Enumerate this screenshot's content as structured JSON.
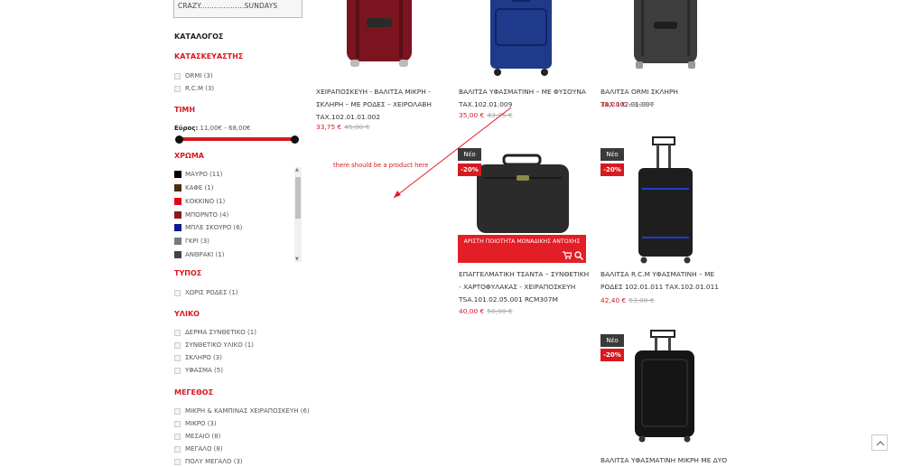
{
  "sidebar": {
    "coupon_text": "CRAZY...................SUNDAYS",
    "catalog_heading": "ΚΑΤΑΛΟΓΟΣ",
    "manufacturer": {
      "heading": "ΚΑΤΑΣΚΕΥΑΣΤΗΣ",
      "items": [
        {
          "label": "ORMI (3)"
        },
        {
          "label": "R.C.M (3)"
        }
      ]
    },
    "price": {
      "heading": "ΤΙΜΗ",
      "range_label": "Εύρος:",
      "range_value": "11,00€ - 68,00€"
    },
    "color": {
      "heading": "ΧΡΩΜΑ",
      "items": [
        {
          "label": "ΜΑΥΡΟ (11)",
          "swatch": "#000000"
        },
        {
          "label": "ΚΑΦΕ (1)",
          "swatch": "#4a2c12"
        },
        {
          "label": "ΚΟΚΚΙΝΟ (1)",
          "swatch": "#e30613"
        },
        {
          "label": "ΜΠΟΡΝΤΟ (4)",
          "swatch": "#8b1a1a"
        },
        {
          "label": "ΜΠΛΕ ΣΚΟΥΡΟ (6)",
          "swatch": "#0b1a8f"
        },
        {
          "label": "ΓΚΡΙ (3)",
          "swatch": "#7a7a7a"
        },
        {
          "label": "ΑΝΘΡΑΚΙ (1)",
          "swatch": "#444444"
        }
      ]
    },
    "type": {
      "heading": "ΤΥΠΟΣ",
      "items": [
        {
          "label": "ΧΩΡΙΣ ΡΟΔΕΣ (1)"
        }
      ]
    },
    "material": {
      "heading": "ΥΛΙΚΟ",
      "items": [
        {
          "label": "ΔΕΡΜΑ ΣΥΝΘΕΤΙΚΟ (1)"
        },
        {
          "label": "ΣΥΝΘΕΤΙΚΟ ΥΛΙΚΟ (1)"
        },
        {
          "label": "ΣΚΛΗΡΟ (3)"
        },
        {
          "label": "ΥΦΑΣΜΑ (5)"
        }
      ]
    },
    "size": {
      "heading": "ΜΕΓΕΘΟΣ",
      "items": [
        {
          "label": "ΜΙΚΡΗ & ΚΑΜΠΙΝΑΣ ΧΕΙΡΑΠΟΣΚΕΥΗ (6)"
        },
        {
          "label": "ΜΙΚΡΟ (3)"
        },
        {
          "label": "ΜΕΣΑΙΟ (8)"
        },
        {
          "label": "ΜΕΓΑΛΟ (8)"
        },
        {
          "label": "ΠΟΛΥ ΜΕΓΑΛΟ (3)"
        }
      ]
    }
  },
  "products": [
    {
      "title": "ΧΕΙΡΑΠΟΣΚΕΥΗ - ΒΑΛΙΤΣΑ ΜΙΚΡΗ - ΣΚΛΗΡΗ – ΜΕ ΡΟΔΕΣ – ΧΕΙΡΟΛΑΒΗ ΤΑΧ.102.01.01.002",
      "price": "33,75 €",
      "old_price": "45,00 €"
    },
    {
      "title": "ΒΑΛΙΤΣΑ ΥΦΑΣΜΑΤΙΝΗ – ΜΕ ΦΥΣΟΥΝΑ ΤΑΧ.102.01.009",
      "price": "35,00 €",
      "old_price": "43,75 €"
    },
    {
      "title": "ΒΑΛΙΤΣΑ ORMI ΣΚΛΗΡΗ ΤΑΧ.102.01.007",
      "price": "39,20 €",
      "old_price": "49,00 €"
    },
    {
      "title": "ΕΠΑΓΓΕΛΜΑΤΙΚΗ ΤΣΑΝΤΑ – ΣΥΝΘΕΤΙΚΗ - ΧΑΡΤΟΦΥΛΑΚΑΣ - ΧΕΙΡΑΠΟΣΚΕΥΗ TSA.101.02.05.001 RCM307M",
      "price": "40,00 €",
      "old_price": "50,00 €",
      "badge_new": "Νέο",
      "badge_discount": "-20%",
      "promo": "ΑΡΙΣΤΗ ΠΟΙΟΤΗΤΑ ΜΟΝΑΔΙΚΗΣ ΑΝΤΟΧΗΣ"
    },
    {
      "title": "ΒΑΛΙΤΣΑ R.C.M ΥΦΑΣΜΑΤΙΝΗ – ΜΕ ΡΟΔΕΣ 102.01.011 ΤΑΧ.102.01.011",
      "price": "42,40 €",
      "old_price": "53,00 €",
      "badge_new": "Νέο",
      "badge_discount": "-20%"
    },
    {
      "title": "ΒΑΛΙΤΣΑ ΥΦΑΣΜΑΤΙΝΗ ΜΙΚΡΗ ΜΕ ΔΥΟ",
      "badge_new": "Νέο",
      "badge_discount": "-20%"
    }
  ],
  "annotation": {
    "text": "there should be a product here",
    "color": "#e31e26"
  },
  "colors": {
    "accent": "#d71920",
    "badge_dark": "#3a3a3a"
  },
  "icons": [
    "cart-icon",
    "zoom-icon",
    "chevron-up-icon"
  ]
}
